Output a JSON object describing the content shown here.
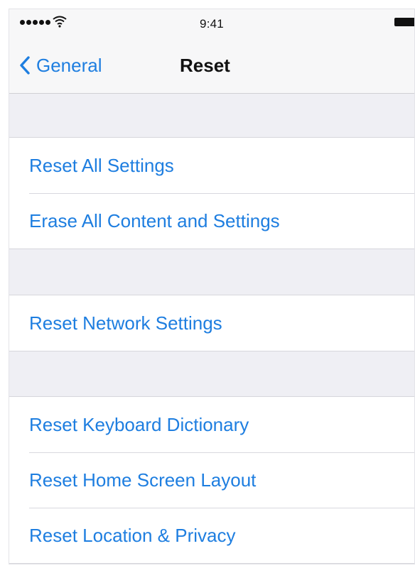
{
  "status_bar": {
    "time": "9:41",
    "signal_icon": "signal-dots-icon",
    "wifi_icon": "wifi-icon",
    "battery_icon": "battery-icon"
  },
  "nav": {
    "back_label": "General",
    "back_icon": "chevron-left-icon",
    "title": "Reset"
  },
  "colors": {
    "accent": "#1e7ee0",
    "background": "#efeff4"
  },
  "groups": [
    {
      "items": [
        {
          "label": "Reset All Settings"
        },
        {
          "label": "Erase All Content and Settings"
        }
      ]
    },
    {
      "items": [
        {
          "label": "Reset Network Settings"
        }
      ]
    },
    {
      "items": [
        {
          "label": "Reset Keyboard Dictionary"
        },
        {
          "label": "Reset Home Screen Layout"
        },
        {
          "label": "Reset Location & Privacy"
        }
      ]
    }
  ]
}
